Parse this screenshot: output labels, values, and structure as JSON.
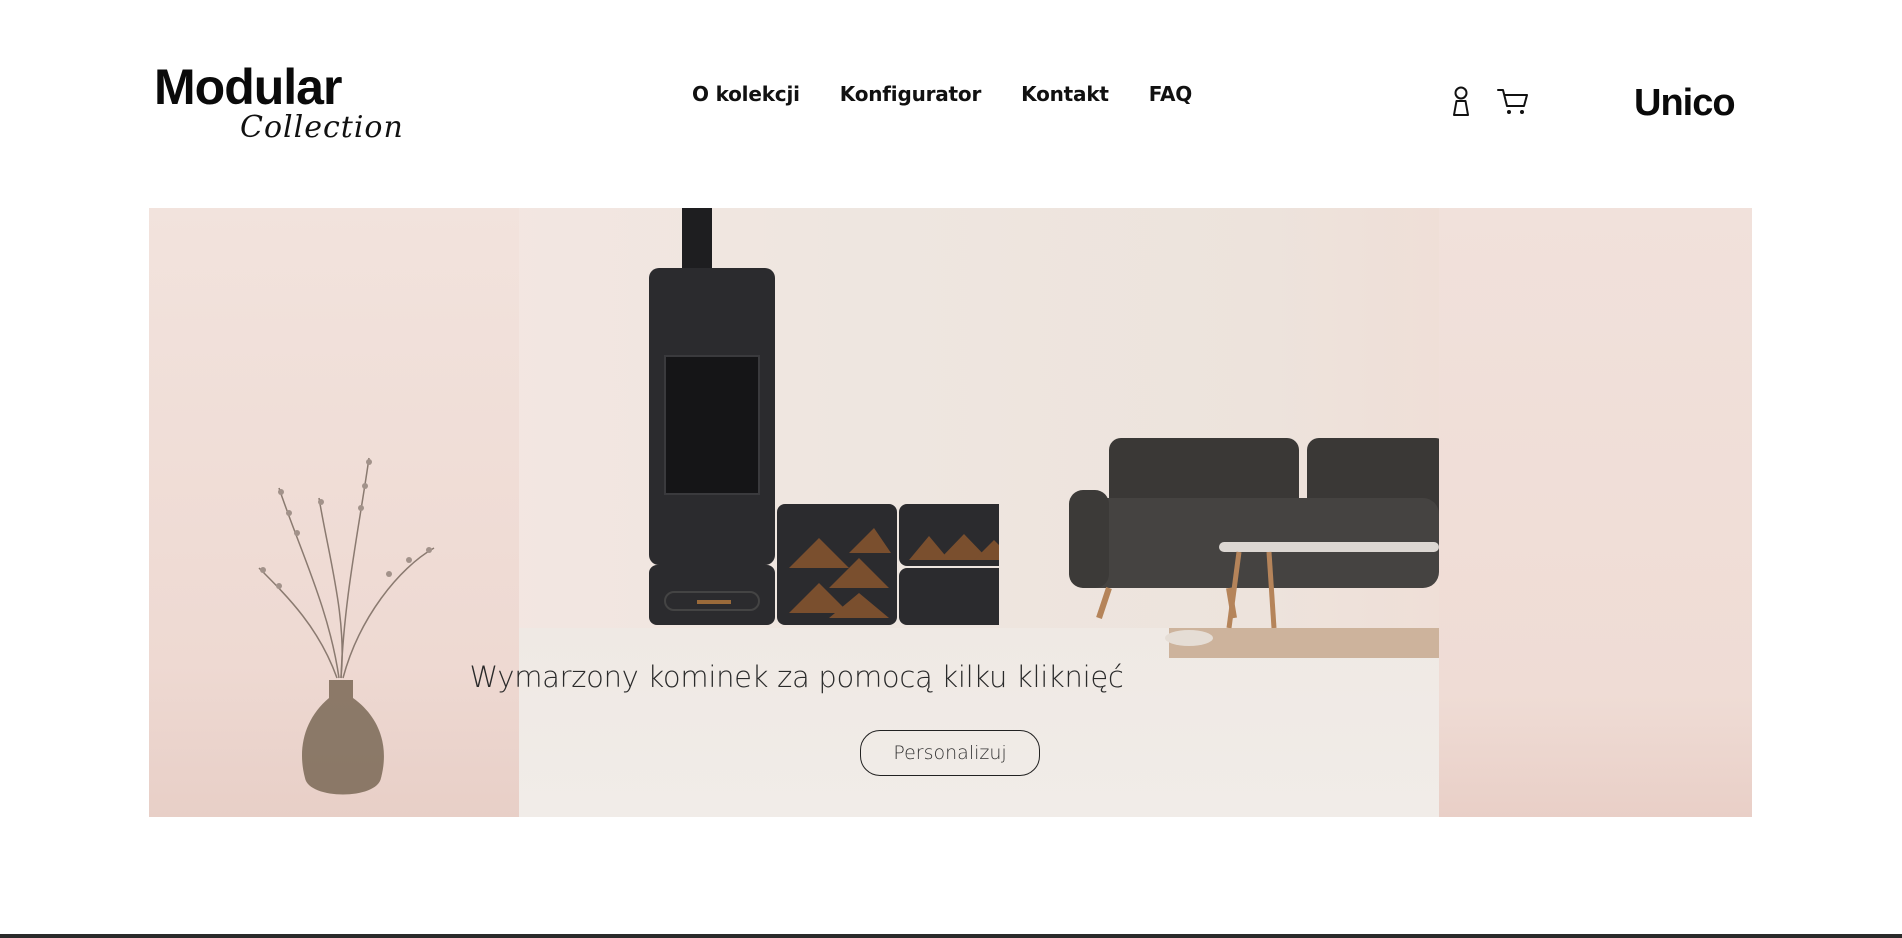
{
  "header": {
    "logo_main": "Modular",
    "logo_sub": "Collection",
    "nav": [
      {
        "label": "O kolekcji"
      },
      {
        "label": "Konfigurator"
      },
      {
        "label": "Kontakt"
      },
      {
        "label": "FAQ"
      }
    ],
    "icons": [
      "user-icon",
      "cart-icon"
    ],
    "brand": "Unico"
  },
  "hero": {
    "headline": "Wymarzony kominek za pomocą kilku kliknięć",
    "cta_label": "Personalizuj"
  }
}
